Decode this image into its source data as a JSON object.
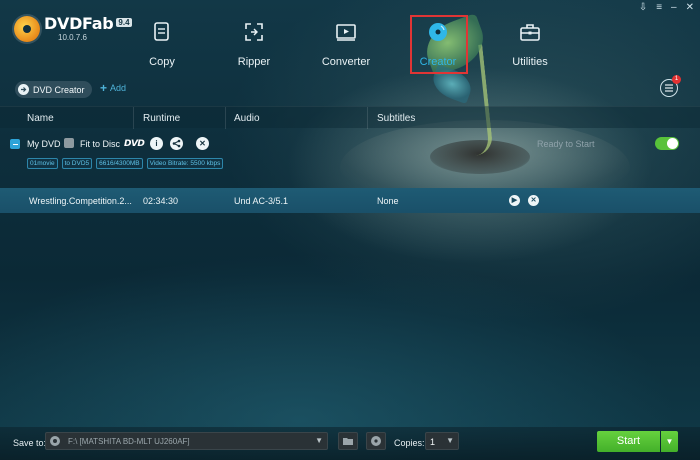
{
  "app": {
    "logo_name": "DVDFab",
    "logo_badge": "9.4",
    "version": "10.0.7.6"
  },
  "window_controls": [
    "⇩",
    "≡",
    "–",
    "✕"
  ],
  "nav": {
    "items": [
      {
        "label": "Copy",
        "icon": "copy-icon"
      },
      {
        "label": "Ripper",
        "icon": "ripper-icon"
      },
      {
        "label": "Converter",
        "icon": "converter-icon"
      },
      {
        "label": "Creator",
        "icon": "creator-disc-icon",
        "active": true
      },
      {
        "label": "Utilities",
        "icon": "toolbox-icon"
      }
    ]
  },
  "toolbar": {
    "mode_label": "DVD Creator",
    "add_label": "Add",
    "queue_badge": "1"
  },
  "columns": {
    "name": "Name",
    "runtime": "Runtime",
    "audio": "Audio",
    "subtitles": "Subtitles"
  },
  "dvd": {
    "name": "My DVD",
    "fit_label": "Fit to Disc",
    "dvd_logo": "DVD",
    "status": "Ready to Start",
    "chips": [
      "01movie",
      "to DVD5",
      "6616/4300MB",
      "Video Bitrate: 5500 kbps"
    ]
  },
  "title_row": {
    "name": "Wrestling.Competition.2...",
    "runtime": "02:34:30",
    "audio": "Und AC-3/5.1",
    "subtitles": "None"
  },
  "bottom": {
    "save_label": "Save to:",
    "save_value": "F:\\ [MATSHITA BD-MLT UJ260AF]",
    "copies_label": "Copies:",
    "copies_value": "1",
    "start_label": "Start"
  },
  "colors": {
    "accent": "#2fb7e8",
    "start_green": "#4fbf2f",
    "highlight_red": "#e03535",
    "toggle_on": "#58c23a"
  }
}
